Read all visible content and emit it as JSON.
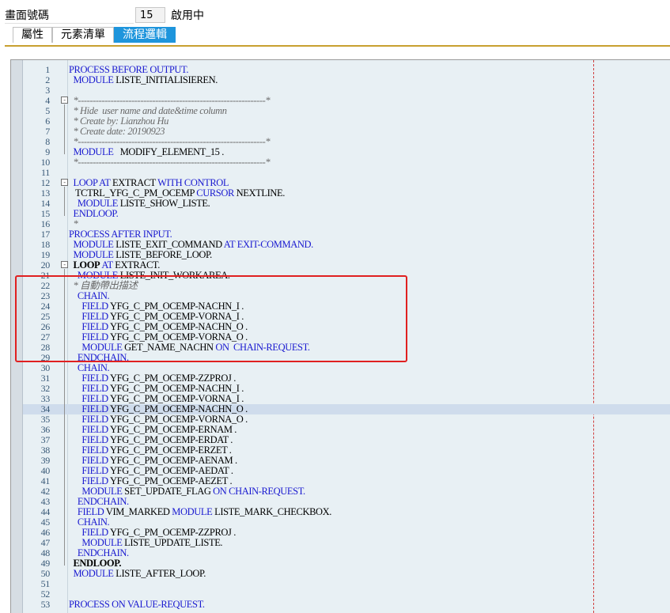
{
  "header": {
    "screen_label": "畫面號碼",
    "screen_number": "15",
    "status": "啟用中"
  },
  "tabs": [
    {
      "label": "屬性",
      "active": false
    },
    {
      "label": "元素清單",
      "active": false
    },
    {
      "label": "流程邏輯",
      "active": true
    }
  ],
  "colors": {
    "keyword": "#1a1ad0",
    "comment": "#6a6a6a",
    "active_tab": "#1e95dc",
    "highlight_box": "#e02020"
  },
  "highlighted_lines": [
    22,
    28
  ],
  "caret_line": 34,
  "code": [
    {
      "n": 1,
      "parts": [
        [
          "kw",
          "PROCESS BEFORE OUTPUT."
        ]
      ]
    },
    {
      "n": 2,
      "parts": [
        [
          "",
          "  "
        ],
        [
          "kw",
          "MODULE"
        ],
        [
          "",
          " LISTE_INITIALISIEREN."
        ]
      ]
    },
    {
      "n": 3,
      "parts": []
    },
    {
      "n": 4,
      "fold": "-",
      "parts": [
        [
          "cm",
          "  *---------------------------------------------------------------*"
        ]
      ]
    },
    {
      "n": 5,
      "parts": [
        [
          "cm",
          "  * Hide  user name and date&time column"
        ]
      ]
    },
    {
      "n": 6,
      "parts": [
        [
          "cm",
          "  * Create by: Lianzhou Hu"
        ]
      ]
    },
    {
      "n": 7,
      "parts": [
        [
          "cm",
          "  * Create date: 20190923"
        ]
      ]
    },
    {
      "n": 8,
      "parts": [
        [
          "cm",
          "  *---------------------------------------------------------------*"
        ]
      ]
    },
    {
      "n": 9,
      "parts": [
        [
          "",
          "  "
        ],
        [
          "kw",
          "MODULE"
        ],
        [
          "",
          "   MODIFY_ELEMENT_15 ."
        ]
      ]
    },
    {
      "n": 10,
      "parts": [
        [
          "cm",
          "  *---------------------------------------------------------------*"
        ]
      ]
    },
    {
      "n": 11,
      "parts": []
    },
    {
      "n": 12,
      "fold": "-",
      "parts": [
        [
          "",
          "  "
        ],
        [
          "kw",
          "LOOP AT"
        ],
        [
          "",
          " EXTRACT "
        ],
        [
          "kw",
          "WITH CONTROL"
        ]
      ]
    },
    {
      "n": 13,
      "parts": [
        [
          "",
          "   TCTRL_YFG_C_PM_OCEMP "
        ],
        [
          "kw",
          "CURSOR"
        ],
        [
          "",
          " NEXTLINE."
        ]
      ]
    },
    {
      "n": 14,
      "parts": [
        [
          "",
          "    "
        ],
        [
          "kw",
          "MODULE"
        ],
        [
          "",
          " LISTE_SHOW_LISTE."
        ]
      ]
    },
    {
      "n": 15,
      "parts": [
        [
          "",
          "  "
        ],
        [
          "kw",
          "ENDLOOP."
        ]
      ]
    },
    {
      "n": 16,
      "parts": [
        [
          "cm",
          "  *"
        ]
      ]
    },
    {
      "n": 17,
      "parts": [
        [
          "kw",
          "PROCESS AFTER INPUT."
        ]
      ]
    },
    {
      "n": 18,
      "parts": [
        [
          "",
          "  "
        ],
        [
          "kw",
          "MODULE"
        ],
        [
          "",
          " LISTE_EXIT_COMMAND "
        ],
        [
          "kw",
          "AT EXIT-COMMAND."
        ]
      ]
    },
    {
      "n": 19,
      "parts": [
        [
          "",
          "  "
        ],
        [
          "kw",
          "MODULE"
        ],
        [
          "",
          " LISTE_BEFORE_LOOP."
        ]
      ]
    },
    {
      "n": 20,
      "fold": "-",
      "parts": [
        [
          "",
          "  "
        ],
        [
          "bold",
          "LOOP"
        ],
        [
          "kw",
          " AT"
        ],
        [
          "",
          " EXTRACT."
        ]
      ]
    },
    {
      "n": 21,
      "parts": [
        [
          "",
          "    "
        ],
        [
          "kw",
          "MODULE"
        ],
        [
          "",
          " LISTE_INIT_WORKAREA."
        ]
      ]
    },
    {
      "n": 22,
      "parts": [
        [
          "cm",
          "  * 自動帶出描述"
        ]
      ]
    },
    {
      "n": 23,
      "parts": [
        [
          "",
          "    "
        ],
        [
          "kw",
          "CHAIN."
        ]
      ]
    },
    {
      "n": 24,
      "parts": [
        [
          "",
          "      "
        ],
        [
          "kw",
          "FIELD"
        ],
        [
          "",
          " YFG_C_PM_OCEMP-NACHN_I ."
        ]
      ]
    },
    {
      "n": 25,
      "parts": [
        [
          "",
          "      "
        ],
        [
          "kw",
          "FIELD"
        ],
        [
          "",
          " YFG_C_PM_OCEMP-VORNA_I ."
        ]
      ]
    },
    {
      "n": 26,
      "parts": [
        [
          "",
          "      "
        ],
        [
          "kw",
          "FIELD"
        ],
        [
          "",
          " YFG_C_PM_OCEMP-NACHN_O ."
        ]
      ]
    },
    {
      "n": 27,
      "parts": [
        [
          "",
          "      "
        ],
        [
          "kw",
          "FIELD"
        ],
        [
          "",
          " YFG_C_PM_OCEMP-VORNA_O ."
        ]
      ]
    },
    {
      "n": 28,
      "parts": [
        [
          "",
          "      "
        ],
        [
          "kw",
          "MODULE"
        ],
        [
          "",
          " GET_NAME_NACHN "
        ],
        [
          "kw",
          "ON  CHAIN-REQUEST."
        ]
      ]
    },
    {
      "n": 29,
      "parts": [
        [
          "",
          "    "
        ],
        [
          "kw",
          "ENDCHAIN."
        ]
      ]
    },
    {
      "n": 30,
      "parts": [
        [
          "",
          "    "
        ],
        [
          "kw",
          "CHAIN."
        ]
      ]
    },
    {
      "n": 31,
      "parts": [
        [
          "",
          "      "
        ],
        [
          "kw",
          "FIELD"
        ],
        [
          "",
          " YFG_C_PM_OCEMP-ZZPROJ ."
        ]
      ]
    },
    {
      "n": 32,
      "parts": [
        [
          "",
          "      "
        ],
        [
          "kw",
          "FIELD"
        ],
        [
          "",
          " YFG_C_PM_OCEMP-NACHN_I ."
        ]
      ]
    },
    {
      "n": 33,
      "parts": [
        [
          "",
          "      "
        ],
        [
          "kw",
          "FIELD"
        ],
        [
          "",
          " YFG_C_PM_OCEMP-VORNA_I ."
        ]
      ]
    },
    {
      "n": 34,
      "parts": [
        [
          "",
          "      "
        ],
        [
          "kw",
          "FIELD"
        ],
        [
          "",
          " YFG_C_PM_OCEMP-NACHN_O ."
        ]
      ]
    },
    {
      "n": 35,
      "parts": [
        [
          "",
          "      "
        ],
        [
          "kw",
          "FIELD"
        ],
        [
          "",
          " YFG_C_PM_OCEMP-VORNA_O ."
        ]
      ]
    },
    {
      "n": 36,
      "parts": [
        [
          "",
          "      "
        ],
        [
          "kw",
          "FIELD"
        ],
        [
          "",
          " YFG_C_PM_OCEMP-ERNAM ."
        ]
      ]
    },
    {
      "n": 37,
      "parts": [
        [
          "",
          "      "
        ],
        [
          "kw",
          "FIELD"
        ],
        [
          "",
          " YFG_C_PM_OCEMP-ERDAT ."
        ]
      ]
    },
    {
      "n": 38,
      "parts": [
        [
          "",
          "      "
        ],
        [
          "kw",
          "FIELD"
        ],
        [
          "",
          " YFG_C_PM_OCEMP-ERZET ."
        ]
      ]
    },
    {
      "n": 39,
      "parts": [
        [
          "",
          "      "
        ],
        [
          "kw",
          "FIELD"
        ],
        [
          "",
          " YFG_C_PM_OCEMP-AENAM ."
        ]
      ]
    },
    {
      "n": 40,
      "parts": [
        [
          "",
          "      "
        ],
        [
          "kw",
          "FIELD"
        ],
        [
          "",
          " YFG_C_PM_OCEMP-AEDAT ."
        ]
      ]
    },
    {
      "n": 41,
      "parts": [
        [
          "",
          "      "
        ],
        [
          "kw",
          "FIELD"
        ],
        [
          "",
          " YFG_C_PM_OCEMP-AEZET ."
        ]
      ]
    },
    {
      "n": 42,
      "parts": [
        [
          "",
          "      "
        ],
        [
          "kw",
          "MODULE"
        ],
        [
          "",
          " SET_UPDATE_FLAG "
        ],
        [
          "kw",
          "ON CHAIN-REQUEST."
        ]
      ]
    },
    {
      "n": 43,
      "parts": [
        [
          "",
          "    "
        ],
        [
          "kw",
          "ENDCHAIN."
        ]
      ]
    },
    {
      "n": 44,
      "parts": [
        [
          "",
          "    "
        ],
        [
          "kw",
          "FIELD"
        ],
        [
          "",
          " VIM_MARKED "
        ],
        [
          "kw",
          "MODULE"
        ],
        [
          "",
          " LISTE_MARK_CHECKBOX."
        ]
      ]
    },
    {
      "n": 45,
      "parts": [
        [
          "",
          "    "
        ],
        [
          "kw",
          "CHAIN."
        ]
      ]
    },
    {
      "n": 46,
      "parts": [
        [
          "",
          "      "
        ],
        [
          "kw",
          "FIELD"
        ],
        [
          "",
          " YFG_C_PM_OCEMP-ZZPROJ ."
        ]
      ]
    },
    {
      "n": 47,
      "parts": [
        [
          "",
          "      "
        ],
        [
          "kw",
          "MODULE"
        ],
        [
          "",
          " LISTE_UPDATE_LISTE."
        ]
      ]
    },
    {
      "n": 48,
      "parts": [
        [
          "",
          "    "
        ],
        [
          "kw",
          "ENDCHAIN."
        ]
      ]
    },
    {
      "n": 49,
      "parts": [
        [
          "",
          "  "
        ],
        [
          "bold",
          "ENDLOOP."
        ]
      ]
    },
    {
      "n": 50,
      "parts": [
        [
          "",
          "  "
        ],
        [
          "kw",
          "MODULE"
        ],
        [
          "",
          " LISTE_AFTER_LOOP."
        ]
      ]
    },
    {
      "n": 51,
      "parts": []
    },
    {
      "n": 52,
      "parts": []
    },
    {
      "n": 53,
      "parts": [
        [
          "kw",
          "PROCESS ON VALUE-REQUEST."
        ]
      ]
    }
  ]
}
